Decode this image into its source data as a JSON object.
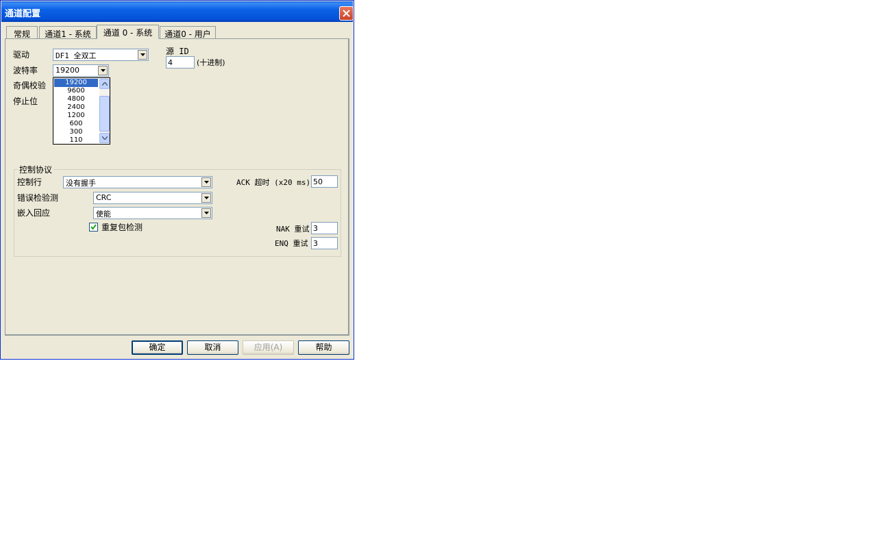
{
  "window": {
    "title": "通道配置"
  },
  "tabs": [
    "常规",
    "通道1 - 系统",
    "通道 0 - 系统",
    "通道0 - 用户"
  ],
  "active_tab": 2,
  "fields": {
    "driver": {
      "label": "驱动",
      "value": "DF1 全双工"
    },
    "baud": {
      "label": "波特率",
      "value": "19200"
    },
    "parity": {
      "label": "奇偶校验"
    },
    "stop_bits": {
      "label": "停止位"
    },
    "source_id": {
      "label": "源 ID",
      "value": "4",
      "suffix": "(十进制)"
    }
  },
  "baud_dropdown": {
    "options": [
      "19200",
      "9600",
      "4800",
      "2400",
      "1200",
      "600",
      "300",
      "110"
    ],
    "selected": "19200"
  },
  "protocol": {
    "group_title": "控制协议",
    "control_line": {
      "label": "控制行",
      "value": "没有握手"
    },
    "error_detection": {
      "label": "错误检验测",
      "value": "CRC"
    },
    "embedded_response": {
      "label": "嵌入回应",
      "value": "使能"
    },
    "duplicate_detect": {
      "label": "重复包检测",
      "checked": true
    },
    "ack_timeout": {
      "label": "ACK 超时 (x20 ms)",
      "value": "50"
    },
    "nak_retries": {
      "label": "NAK 重试",
      "value": "3"
    },
    "enq_retries": {
      "label": "ENQ 重试",
      "value": "3"
    }
  },
  "buttons": {
    "ok": "确定",
    "cancel": "取消",
    "apply": "应用(A)",
    "help": "帮助"
  },
  "colors": {
    "titlebar": "#0b62e6",
    "dialog_bg": "#ece9d8",
    "selection": "#316ac5"
  }
}
